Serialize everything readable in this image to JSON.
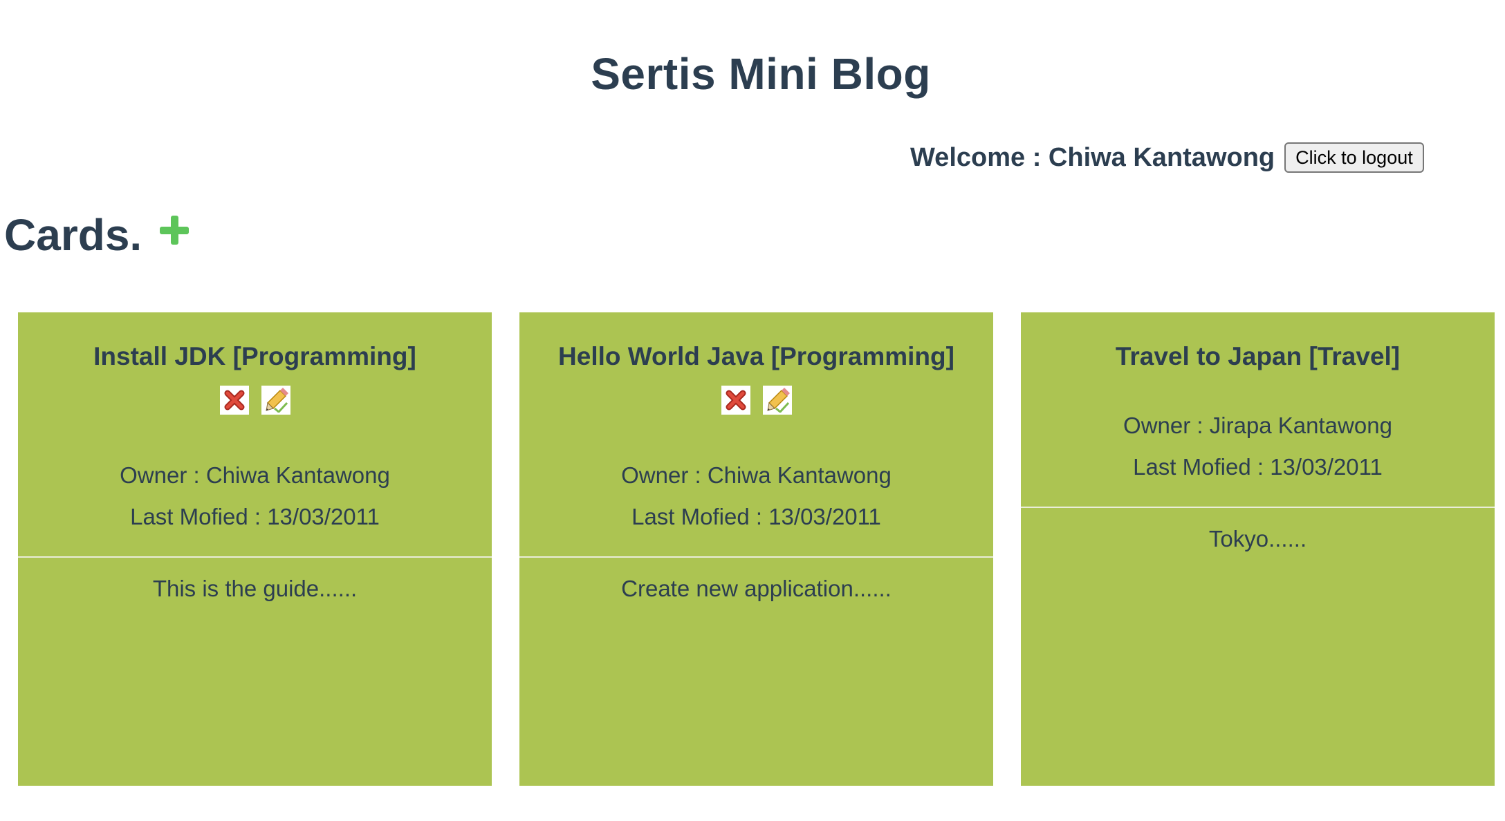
{
  "header": {
    "title": "Sertis Mini Blog",
    "welcome": "Welcome : Chiwa Kantawong",
    "logout_label": "Click to logout"
  },
  "section": {
    "title": "Cards.",
    "add_icon": "plus-icon"
  },
  "colors": {
    "card_background": "#acc452",
    "text": "#2c3e50",
    "add_icon": "#5dc55a",
    "delete_icon": "#c0392b"
  },
  "cards": [
    {
      "title": "Install JDK [Programming]",
      "has_actions": true,
      "owner": "Owner : Chiwa Kantawong",
      "last_modified": "Last Mofied : 13/03/2011",
      "body": "This is the guide......"
    },
    {
      "title": "Hello World Java [Programming]",
      "has_actions": true,
      "owner": "Owner : Chiwa Kantawong",
      "last_modified": "Last Mofied : 13/03/2011",
      "body": "Create new application......"
    },
    {
      "title": "Travel to Japan [Travel]",
      "has_actions": false,
      "owner": "Owner : Jirapa Kantawong",
      "last_modified": "Last Mofied : 13/03/2011",
      "body": "Tokyo......"
    }
  ]
}
